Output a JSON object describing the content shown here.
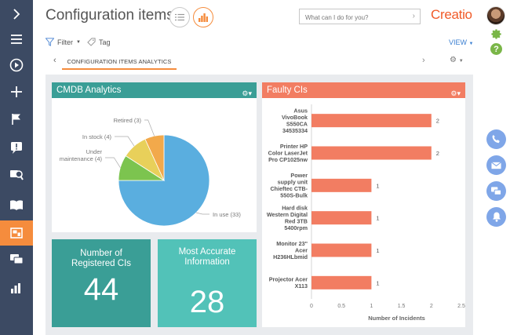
{
  "header": {
    "title": "Configuration items",
    "search": {
      "placeholder": "What can I do for you?"
    },
    "logo": "Creatio"
  },
  "toolbar": {
    "filter_label": "Filter",
    "tag_label": "Tag",
    "view_label": "VIEW"
  },
  "tabs": [
    {
      "label": "CONFIGURATION ITEMS ANALYTICS",
      "active": true
    }
  ],
  "nav": {
    "items": [
      {
        "icon": "chevron-right-icon"
      },
      {
        "icon": "hamburger-menu-icon"
      },
      {
        "icon": "play-icon"
      },
      {
        "icon": "plus-icon"
      },
      {
        "icon": "flag-icon"
      },
      {
        "icon": "alert-icon"
      },
      {
        "icon": "knowledge-search-icon"
      },
      {
        "icon": "book-icon"
      },
      {
        "icon": "dashboard-icon",
        "active": true
      },
      {
        "icon": "chat-icon"
      },
      {
        "icon": "bar-chart-icon"
      }
    ]
  },
  "colors": {
    "nav_bg": "#3c4a63",
    "accent": "#f58c3d",
    "cmdb_header": "#3a9e96",
    "faulty_header": "#f27d62",
    "metric_dark": "#3a9e96",
    "metric_light": "#52c2b8",
    "bar": "#f27d62",
    "comm_blue": "#7fa6e8",
    "green_icon": "#7ab648"
  },
  "panels": {
    "cmdb": {
      "title": "CMDB Analytics"
    },
    "faulty": {
      "title": "Faulty CIs"
    },
    "registered": {
      "label_line1": "Number of",
      "label_line2": "Registered CIs",
      "value": "44"
    },
    "accurate": {
      "label_line1": "Most Accurate",
      "label_line2": "Information",
      "value": "28"
    }
  },
  "chart_data": [
    {
      "type": "pie",
      "title": "CMDB Analytics",
      "slices": [
        {
          "label": "In use",
          "value": 33,
          "display": "In use (33)",
          "color": "#5aaedf"
        },
        {
          "label": "Under maintenance",
          "value": 4,
          "display_line1": "Under",
          "display_line2": "maintenance (4)",
          "color": "#7cc44f"
        },
        {
          "label": "In stock",
          "value": 4,
          "display": "In stock (4)",
          "color": "#e8d05a"
        },
        {
          "label": "Retired",
          "value": 3,
          "display": "Retired (3)",
          "color": "#f2a94b"
        }
      ]
    },
    {
      "type": "bar",
      "orientation": "horizontal",
      "title": "Faulty CIs",
      "xlabel": "Number of Incidents",
      "xlim": [
        0,
        2.5
      ],
      "xticks": [
        "0",
        "0.5",
        "1",
        "1.5",
        "2",
        "2.5"
      ],
      "categories": [
        [
          "Asus",
          "VivoBook",
          "S550CA",
          "34535334"
        ],
        [
          "Printer HP",
          "Color LaserJet",
          "Pro CP1025nw"
        ],
        [
          "Power",
          "supply unit",
          "Chieftec CTB-",
          "550S-Bulk"
        ],
        [
          "Hard disk",
          "Western Digital",
          "Red 3TB",
          "5400rpm"
        ],
        [
          "Monitor 23\"",
          "Acer",
          "H236HLbmid"
        ],
        [
          "Projector Acer",
          "X113"
        ]
      ],
      "values": [
        2,
        2,
        1,
        1,
        1,
        1
      ]
    }
  ]
}
